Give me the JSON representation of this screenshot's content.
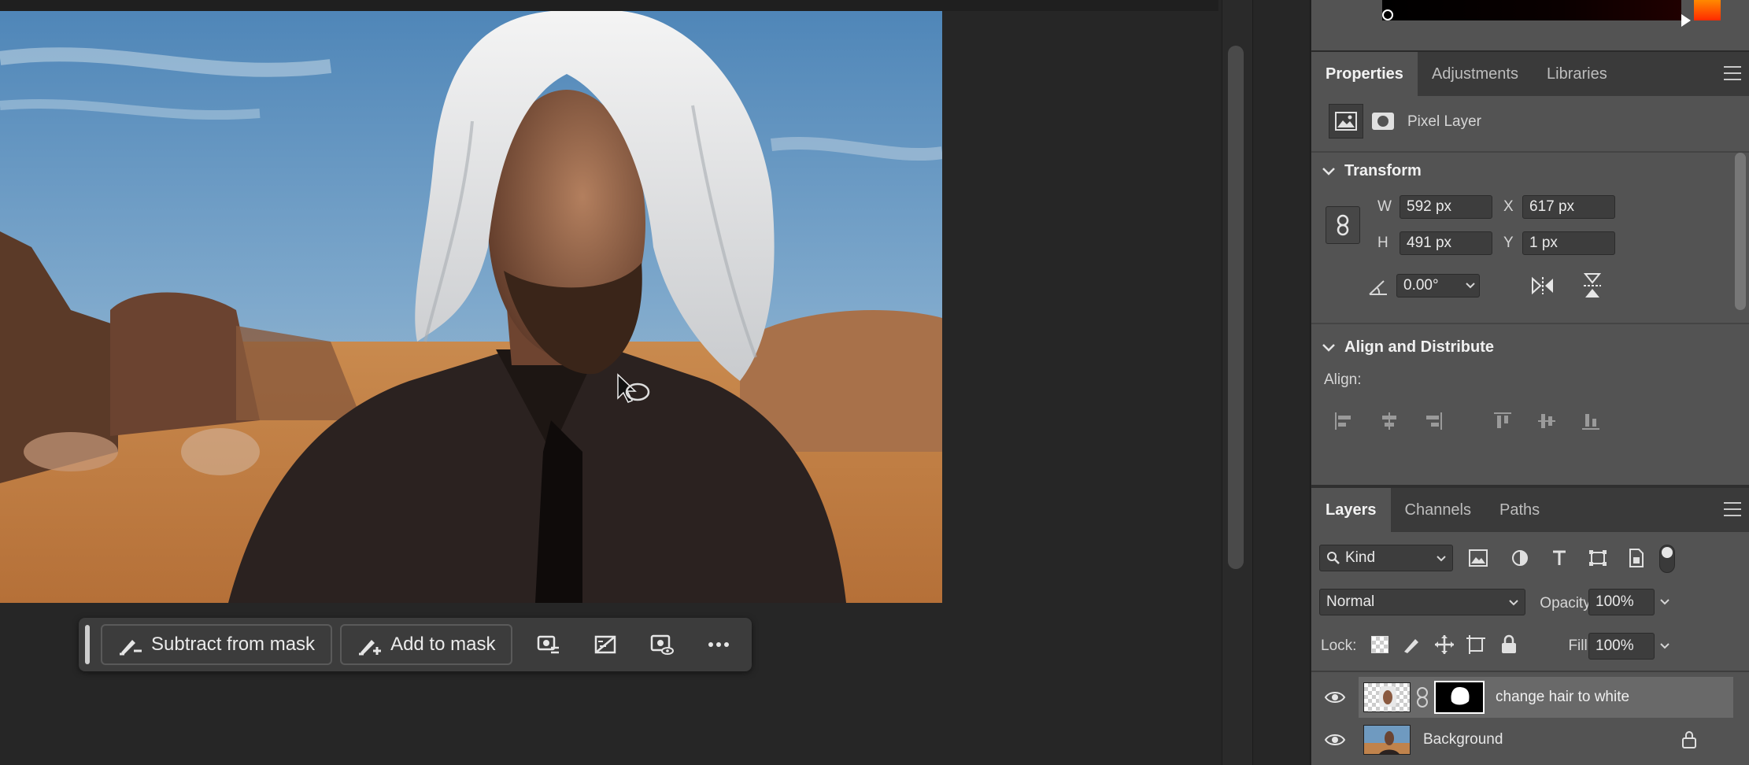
{
  "taskbar": {
    "subtract_label": "Subtract from mask",
    "add_label": "Add to mask",
    "icons": [
      "mask-settings-icon",
      "invert-mask-icon",
      "view-mask-icon",
      "more-icon"
    ]
  },
  "properties_panel": {
    "tabs": [
      "Properties",
      "Adjustments",
      "Libraries"
    ],
    "active_tab": "Properties",
    "layer_type": "Pixel Layer",
    "transform": {
      "title": "Transform",
      "w_label": "W",
      "w_value": "592 px",
      "x_label": "X",
      "x_value": "617 px",
      "h_label": "H",
      "h_value": "491 px",
      "y_label": "Y",
      "y_value": "1 px",
      "angle_value": "0.00°"
    },
    "align": {
      "title": "Align and Distribute",
      "align_label": "Align:"
    }
  },
  "layers_panel": {
    "tabs": [
      "Layers",
      "Channels",
      "Paths"
    ],
    "active_tab": "Layers",
    "filter_kind": "Kind",
    "blend_mode": "Normal",
    "opacity_label": "Opacity:",
    "opacity_value": "100%",
    "lock_label": "Lock:",
    "fill_label": "Fill:",
    "fill_value": "100%",
    "layers": [
      {
        "name": "change hair to white",
        "visible": true,
        "selected": true,
        "has_mask": true
      },
      {
        "name": "Background",
        "visible": true,
        "selected": false,
        "locked": true
      }
    ]
  },
  "colors": {
    "panel_bg": "#535353",
    "tab_bar": "#3a3a3a",
    "app_bg": "#262626",
    "selected_row": "#696969"
  }
}
